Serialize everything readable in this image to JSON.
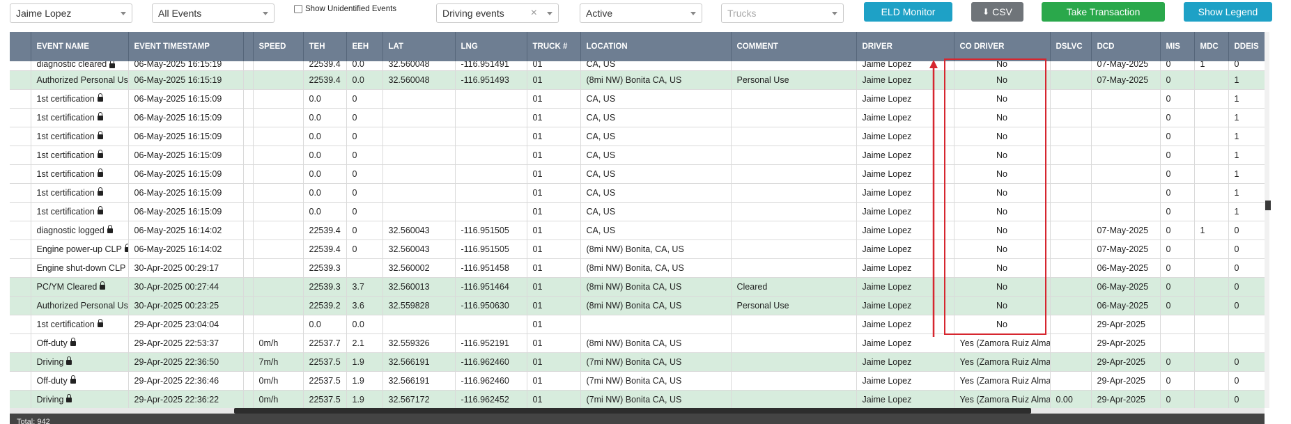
{
  "toolbar": {
    "driver_select": "Jaime Lopez",
    "events_select": "All Events",
    "show_unidentified_label": "Show Unidentified Events",
    "event_type_select": "Driving events",
    "status_select": "Active",
    "trucks_placeholder": "Trucks",
    "eld_monitor_label": "ELD Monitor",
    "csv_label": "CSV",
    "take_transaction_label": "Take Transaction",
    "show_legend_label": "Show Legend"
  },
  "columns": [
    "EVENT NAME",
    "EVENT TIMESTAMP",
    "SPEED",
    "TEH",
    "EEH",
    "LAT",
    "LNG",
    "TRUCK #",
    "LOCATION",
    "COMMENT",
    "DRIVER",
    "CO DRIVER",
    "DSLVC",
    "DCD",
    "MIS",
    "MDC",
    "DDEIS"
  ],
  "rows": [
    {
      "event_name": "diagnostic cleared",
      "lock": true,
      "timestamp": "06-May-2025 16:15:19",
      "speed": "",
      "teh": "22539.4",
      "eeh": "0.0",
      "lat": "32.560048",
      "lng": "-116.951491",
      "truck": "01",
      "location": "CA, US",
      "comment": "",
      "driver": "Jaime Lopez",
      "co_driver": "No",
      "dslvc": "",
      "dcd": "07-May-2025",
      "mis": "0",
      "mdc": "1",
      "ddeis": "0",
      "green": false,
      "first": true
    },
    {
      "event_name": "Authorized Personal Use",
      "lock": false,
      "timestamp": "06-May-2025 16:15:19",
      "speed": "",
      "teh": "22539.4",
      "eeh": "0.0",
      "lat": "32.560048",
      "lng": "-116.951493",
      "truck": "01",
      "location": "(8mi NW) Bonita CA, US",
      "comment": "Personal Use",
      "driver": "Jaime Lopez",
      "co_driver": "No",
      "dslvc": "",
      "dcd": "07-May-2025",
      "mis": "0",
      "mdc": "",
      "ddeis": "1",
      "green": true
    },
    {
      "event_name": "1st certification",
      "lock": true,
      "timestamp": "06-May-2025 16:15:09",
      "speed": "",
      "teh": "0.0",
      "eeh": "0",
      "lat": "",
      "lng": "",
      "truck": "01",
      "location": "CA, US",
      "comment": "",
      "driver": "Jaime Lopez",
      "co_driver": "No",
      "dslvc": "",
      "dcd": "",
      "mis": "0",
      "mdc": "",
      "ddeis": "1",
      "green": false
    },
    {
      "event_name": "1st certification",
      "lock": true,
      "timestamp": "06-May-2025 16:15:09",
      "speed": "",
      "teh": "0.0",
      "eeh": "0",
      "lat": "",
      "lng": "",
      "truck": "01",
      "location": "CA, US",
      "comment": "",
      "driver": "Jaime Lopez",
      "co_driver": "No",
      "dslvc": "",
      "dcd": "",
      "mis": "0",
      "mdc": "",
      "ddeis": "1",
      "green": false
    },
    {
      "event_name": "1st certification",
      "lock": true,
      "timestamp": "06-May-2025 16:15:09",
      "speed": "",
      "teh": "0.0",
      "eeh": "0",
      "lat": "",
      "lng": "",
      "truck": "01",
      "location": "CA, US",
      "comment": "",
      "driver": "Jaime Lopez",
      "co_driver": "No",
      "dslvc": "",
      "dcd": "",
      "mis": "0",
      "mdc": "",
      "ddeis": "1",
      "green": false
    },
    {
      "event_name": "1st certification",
      "lock": true,
      "timestamp": "06-May-2025 16:15:09",
      "speed": "",
      "teh": "0.0",
      "eeh": "0",
      "lat": "",
      "lng": "",
      "truck": "01",
      "location": "CA, US",
      "comment": "",
      "driver": "Jaime Lopez",
      "co_driver": "No",
      "dslvc": "",
      "dcd": "",
      "mis": "0",
      "mdc": "",
      "ddeis": "1",
      "green": false
    },
    {
      "event_name": "1st certification",
      "lock": true,
      "timestamp": "06-May-2025 16:15:09",
      "speed": "",
      "teh": "0.0",
      "eeh": "0",
      "lat": "",
      "lng": "",
      "truck": "01",
      "location": "CA, US",
      "comment": "",
      "driver": "Jaime Lopez",
      "co_driver": "No",
      "dslvc": "",
      "dcd": "",
      "mis": "0",
      "mdc": "",
      "ddeis": "1",
      "green": false
    },
    {
      "event_name": "1st certification",
      "lock": true,
      "timestamp": "06-May-2025 16:15:09",
      "speed": "",
      "teh": "0.0",
      "eeh": "0",
      "lat": "",
      "lng": "",
      "truck": "01",
      "location": "CA, US",
      "comment": "",
      "driver": "Jaime Lopez",
      "co_driver": "No",
      "dslvc": "",
      "dcd": "",
      "mis": "0",
      "mdc": "",
      "ddeis": "1",
      "green": false
    },
    {
      "event_name": "1st certification",
      "lock": true,
      "timestamp": "06-May-2025 16:15:09",
      "speed": "",
      "teh": "0.0",
      "eeh": "0",
      "lat": "",
      "lng": "",
      "truck": "01",
      "location": "CA, US",
      "comment": "",
      "driver": "Jaime Lopez",
      "co_driver": "No",
      "dslvc": "",
      "dcd": "",
      "mis": "0",
      "mdc": "",
      "ddeis": "1",
      "green": false
    },
    {
      "event_name": "diagnostic logged",
      "lock": true,
      "timestamp": "06-May-2025 16:14:02",
      "speed": "",
      "teh": "22539.4",
      "eeh": "0",
      "lat": "32.560043",
      "lng": "-116.951505",
      "truck": "01",
      "location": "CA, US",
      "comment": "",
      "driver": "Jaime Lopez",
      "co_driver": "No",
      "dslvc": "",
      "dcd": "07-May-2025",
      "mis": "0",
      "mdc": "1",
      "ddeis": "0",
      "green": false
    },
    {
      "event_name": "Engine power-up CLP",
      "lock": true,
      "timestamp": "06-May-2025 16:14:02",
      "speed": "",
      "teh": "22539.4",
      "eeh": "0",
      "lat": "32.560043",
      "lng": "-116.951505",
      "truck": "01",
      "location": "(8mi NW) Bonita, CA, US",
      "comment": "",
      "driver": "Jaime Lopez",
      "co_driver": "No",
      "dslvc": "",
      "dcd": "07-May-2025",
      "mis": "0",
      "mdc": "",
      "ddeis": "0",
      "green": false
    },
    {
      "event_name": "Engine shut-down CLP",
      "lock": true,
      "timestamp": "30-Apr-2025 00:29:17",
      "speed": "",
      "teh": "22539.3",
      "eeh": "",
      "lat": "32.560002",
      "lng": "-116.951458",
      "truck": "01",
      "location": "(8mi NW) Bonita, CA, US",
      "comment": "",
      "driver": "Jaime Lopez",
      "co_driver": "No",
      "dslvc": "",
      "dcd": "06-May-2025",
      "mis": "0",
      "mdc": "",
      "ddeis": "0",
      "green": false
    },
    {
      "event_name": "PC/YM Cleared",
      "lock": true,
      "timestamp": "30-Apr-2025 00:27:44",
      "speed": "",
      "teh": "22539.3",
      "eeh": "3.7",
      "lat": "32.560013",
      "lng": "-116.951464",
      "truck": "01",
      "location": "(8mi NW) Bonita CA, US",
      "comment": "Cleared",
      "driver": "Jaime Lopez",
      "co_driver": "No",
      "dslvc": "",
      "dcd": "06-May-2025",
      "mis": "0",
      "mdc": "",
      "ddeis": "0",
      "green": true
    },
    {
      "event_name": "Authorized Personal Use",
      "lock": false,
      "timestamp": "30-Apr-2025 00:23:25",
      "speed": "",
      "teh": "22539.2",
      "eeh": "3.6",
      "lat": "32.559828",
      "lng": "-116.950630",
      "truck": "01",
      "location": "(8mi NW) Bonita CA, US",
      "comment": "Personal Use",
      "driver": "Jaime Lopez",
      "co_driver": "No",
      "dslvc": "",
      "dcd": "06-May-2025",
      "mis": "0",
      "mdc": "",
      "ddeis": "0",
      "green": true
    },
    {
      "event_name": "1st certification",
      "lock": true,
      "timestamp": "29-Apr-2025 23:04:04",
      "speed": "",
      "teh": "0.0",
      "eeh": "0.0",
      "lat": "",
      "lng": "",
      "truck": "01",
      "location": "",
      "comment": "",
      "driver": "Jaime Lopez",
      "co_driver": "No",
      "dslvc": "",
      "dcd": "29-Apr-2025",
      "mis": "",
      "mdc": "",
      "ddeis": "",
      "green": false
    },
    {
      "event_name": "Off-duty",
      "lock": true,
      "timestamp": "29-Apr-2025 22:53:37",
      "speed": "0m/h",
      "teh": "22537.7",
      "eeh": "2.1",
      "lat": "32.559326",
      "lng": "-116.952191",
      "truck": "01",
      "location": "(8mi NW) Bonita CA, US",
      "comment": "",
      "driver": "Jaime Lopez",
      "co_driver": "Yes (Zamora Ruiz Alma",
      "dslvc": "",
      "dcd": "29-Apr-2025",
      "mis": "",
      "mdc": "",
      "ddeis": "",
      "green": false
    },
    {
      "event_name": "Driving",
      "lock": true,
      "timestamp": "29-Apr-2025 22:36:50",
      "speed": "7m/h",
      "teh": "22537.5",
      "eeh": "1.9",
      "lat": "32.566191",
      "lng": "-116.962460",
      "truck": "01",
      "location": "(7mi NW) Bonita CA, US",
      "comment": "",
      "driver": "Jaime Lopez",
      "co_driver": "Yes (Zamora Ruiz Alma",
      "dslvc": "",
      "dcd": "29-Apr-2025",
      "mis": "0",
      "mdc": "",
      "ddeis": "0",
      "green": true
    },
    {
      "event_name": "Off-duty",
      "lock": true,
      "timestamp": "29-Apr-2025 22:36:46",
      "speed": "0m/h",
      "teh": "22537.5",
      "eeh": "1.9",
      "lat": "32.566191",
      "lng": "-116.962460",
      "truck": "01",
      "location": "(7mi NW) Bonita CA, US",
      "comment": "",
      "driver": "Jaime Lopez",
      "co_driver": "Yes (Zamora Ruiz Alma",
      "dslvc": "",
      "dcd": "29-Apr-2025",
      "mis": "0",
      "mdc": "",
      "ddeis": "0",
      "green": false
    },
    {
      "event_name": "Driving",
      "lock": true,
      "timestamp": "29-Apr-2025 22:36:22",
      "speed": "0m/h",
      "teh": "22537.5",
      "eeh": "1.9",
      "lat": "32.567172",
      "lng": "-116.962452",
      "truck": "01",
      "location": "(7mi NW) Bonita CA, US",
      "comment": "",
      "driver": "Jaime Lopez",
      "co_driver": "Yes (Zamora Ruiz Alma",
      "dslvc": "0.00",
      "dcd": "29-Apr-2025",
      "mis": "0",
      "mdc": "",
      "ddeis": "0",
      "green": true
    }
  ],
  "footer": {
    "total": "Total: 942"
  },
  "colors": {
    "header": "#6e7e92",
    "green_row": "#d7ecdd",
    "annotation": "#d6262f",
    "teal_button": "#1ea1c6",
    "green_button": "#2aa84b"
  }
}
